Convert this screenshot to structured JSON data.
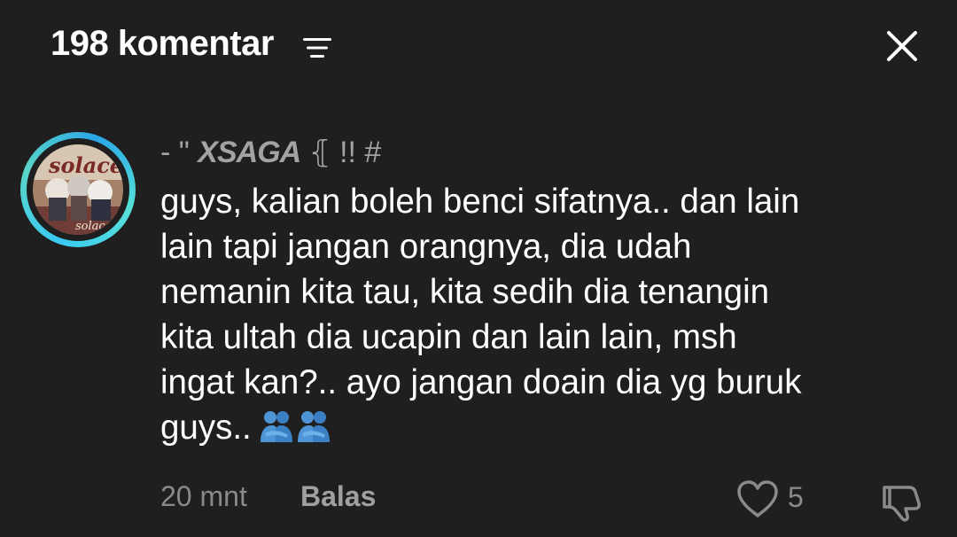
{
  "header": {
    "comment_count_label": "198 komentar",
    "filter_icon": "filter-lines-icon",
    "close_icon": "close-x-icon"
  },
  "comment": {
    "avatar_icon": "user-avatar",
    "username_prefix": "- \" ",
    "username_brand": "XSAGA",
    "username_suffix": " ⦃  !! #",
    "text": "guys, kalian boleh benci sifatnya.. dan lain\nlain tapi jangan orangnya, dia udah\nnemanin kita tau, kita sedih dia tenangin\nkita ultah dia ucapin dan lain lain, msh\ningat kan?.. ayo jangan doain dia yg buruk\nguys..",
    "emoji": "people-hugging-emoji",
    "timestamp": "20 mnt",
    "reply_label": "Balas",
    "like_count": "5",
    "like_icon": "heart-outline-icon",
    "dislike_icon": "thumbs-down-icon"
  },
  "colors": {
    "background": "#1f1f1f",
    "primary_text": "#ffffff",
    "secondary_text": "#8a8a8a",
    "avatar_ring": "#39c9f2",
    "emoji": "#4f95d6"
  }
}
